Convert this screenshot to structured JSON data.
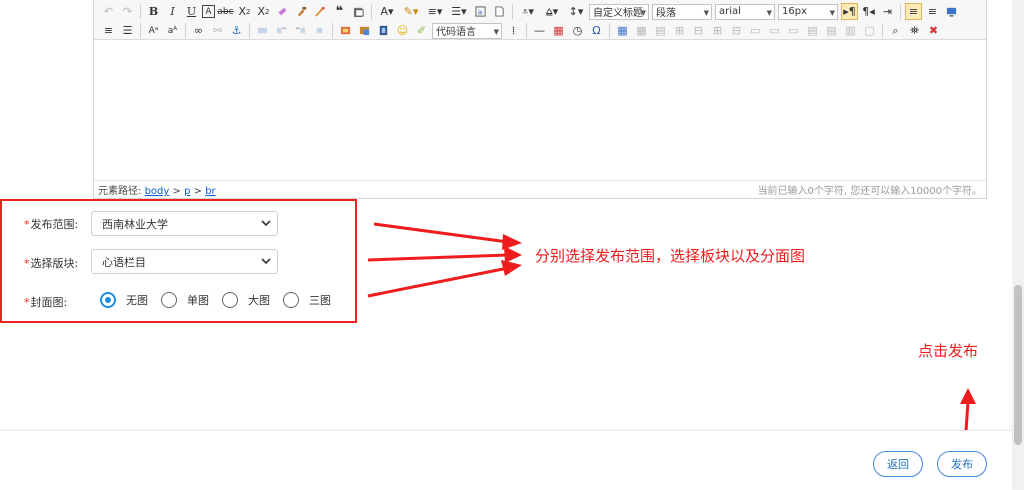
{
  "toolbar": {
    "custom_heading_select": "自定义标题",
    "paragraph_select": "段落",
    "font_family_select": "arial",
    "font_size_select": "16px",
    "code_language_select": "代码语言"
  },
  "statusbar": {
    "path_label": "元素路径:",
    "path_items": [
      "body",
      "p",
      "br"
    ],
    "path_separator": ">",
    "char_count": "当前已输入0个字符, 您还可以输入10000个字符。"
  },
  "form": {
    "scope_label": "发布范围:",
    "scope_value": "西南林业大学",
    "section_label": "选择版块:",
    "section_value": "心语栏目",
    "cover_label": "封面图:",
    "required_mark": "*",
    "cover_options": [
      {
        "label": "无图",
        "checked": true
      },
      {
        "label": "单图",
        "checked": false
      },
      {
        "label": "大图",
        "checked": false
      },
      {
        "label": "三图",
        "checked": false
      }
    ]
  },
  "annotations": {
    "instruction": "分别选择发布范围，选择板块以及分面图",
    "click_publish": "点击发布",
    "color": "#ee1c1c"
  },
  "footer": {
    "back_label": "返回",
    "publish_label": "发布",
    "accent": "#3f8ad8"
  }
}
